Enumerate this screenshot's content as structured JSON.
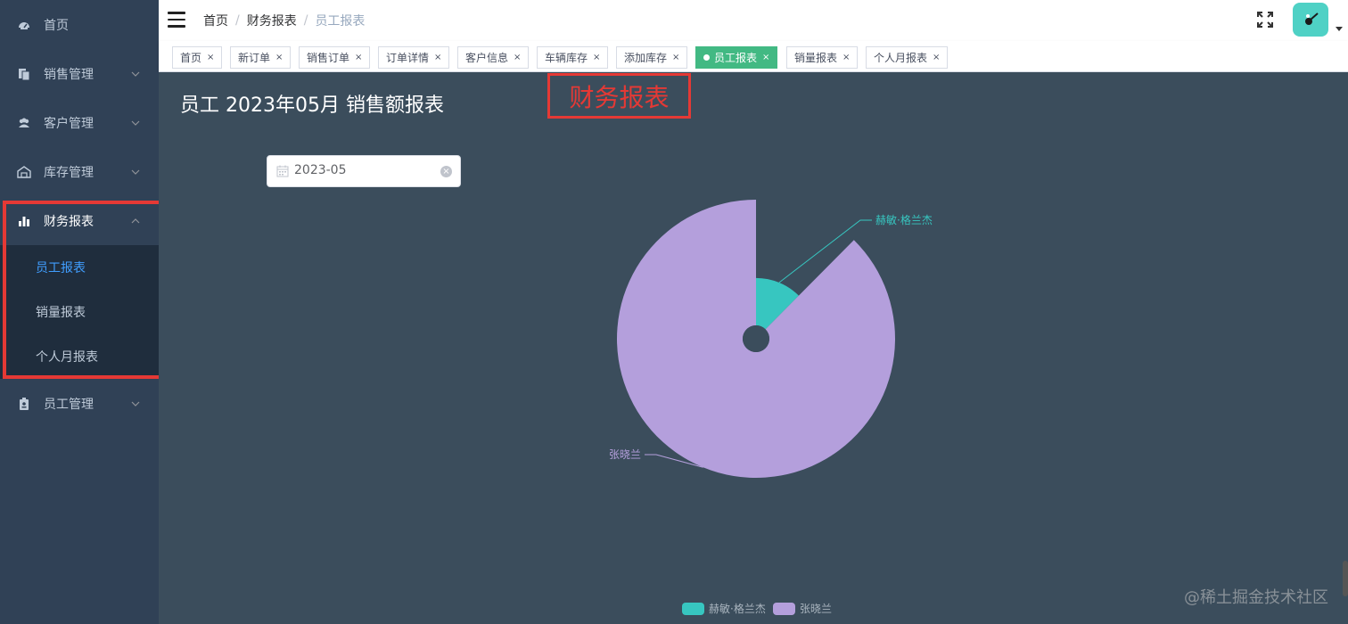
{
  "sidebar": {
    "items": [
      {
        "label": "首页"
      },
      {
        "label": "销售管理"
      },
      {
        "label": "客户管理"
      },
      {
        "label": "库存管理"
      },
      {
        "label": "财务报表"
      },
      {
        "label": "员工管理"
      }
    ],
    "submenu": [
      {
        "label": "员工报表",
        "active": true
      },
      {
        "label": "销量报表"
      },
      {
        "label": "个人月报表"
      }
    ]
  },
  "breadcrumb": [
    "首页",
    "财务报表",
    "员工报表"
  ],
  "tags": [
    {
      "label": "首页"
    },
    {
      "label": "新订单"
    },
    {
      "label": "销售订单"
    },
    {
      "label": "订单详情"
    },
    {
      "label": "客户信息"
    },
    {
      "label": "车辆库存"
    },
    {
      "label": "添加库存"
    },
    {
      "label": "员工报表",
      "active": true
    },
    {
      "label": "销量报表"
    },
    {
      "label": "个人月报表"
    }
  ],
  "main": {
    "title": "员工 2023年05月 销售额报表",
    "annotation": "财务报表",
    "date_value": "2023-05",
    "watermark": "@稀土掘金技术社区"
  },
  "colors": {
    "sidebar_bg": "#304156",
    "main_bg": "#3b4d5c",
    "tag_active": "#42b983",
    "menu_active": "#409eff",
    "annotation_red": "#e53935"
  },
  "chart_data": {
    "type": "pie",
    "subtype": "nightingale-rose",
    "categories": [
      "赫敏·格兰杰",
      "张晓兰"
    ],
    "values": [
      22,
      155
    ],
    "colors": [
      "#37c6c0",
      "#b49fdc"
    ],
    "legend": [
      "赫敏·格兰杰",
      "张晓兰"
    ],
    "legend_position": "bottom"
  }
}
